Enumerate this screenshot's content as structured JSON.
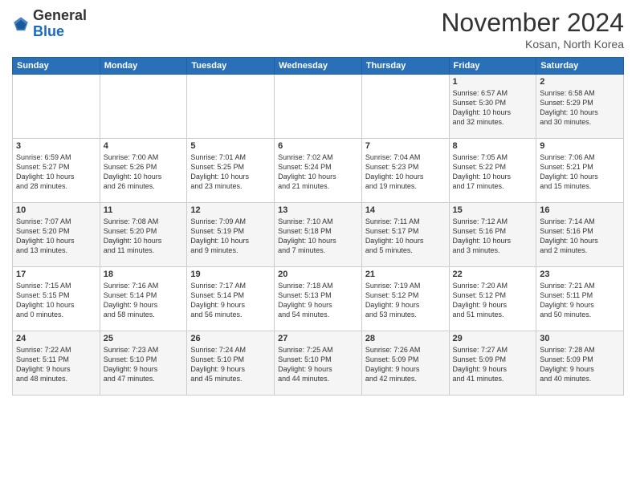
{
  "header": {
    "logo_general": "General",
    "logo_blue": "Blue",
    "month_title": "November 2024",
    "location": "Kosan, North Korea"
  },
  "weekdays": [
    "Sunday",
    "Monday",
    "Tuesday",
    "Wednesday",
    "Thursday",
    "Friday",
    "Saturday"
  ],
  "weeks": [
    [
      {
        "day": "",
        "info": ""
      },
      {
        "day": "",
        "info": ""
      },
      {
        "day": "",
        "info": ""
      },
      {
        "day": "",
        "info": ""
      },
      {
        "day": "",
        "info": ""
      },
      {
        "day": "1",
        "info": "Sunrise: 6:57 AM\nSunset: 5:30 PM\nDaylight: 10 hours\nand 32 minutes."
      },
      {
        "day": "2",
        "info": "Sunrise: 6:58 AM\nSunset: 5:29 PM\nDaylight: 10 hours\nand 30 minutes."
      }
    ],
    [
      {
        "day": "3",
        "info": "Sunrise: 6:59 AM\nSunset: 5:27 PM\nDaylight: 10 hours\nand 28 minutes."
      },
      {
        "day": "4",
        "info": "Sunrise: 7:00 AM\nSunset: 5:26 PM\nDaylight: 10 hours\nand 26 minutes."
      },
      {
        "day": "5",
        "info": "Sunrise: 7:01 AM\nSunset: 5:25 PM\nDaylight: 10 hours\nand 23 minutes."
      },
      {
        "day": "6",
        "info": "Sunrise: 7:02 AM\nSunset: 5:24 PM\nDaylight: 10 hours\nand 21 minutes."
      },
      {
        "day": "7",
        "info": "Sunrise: 7:04 AM\nSunset: 5:23 PM\nDaylight: 10 hours\nand 19 minutes."
      },
      {
        "day": "8",
        "info": "Sunrise: 7:05 AM\nSunset: 5:22 PM\nDaylight: 10 hours\nand 17 minutes."
      },
      {
        "day": "9",
        "info": "Sunrise: 7:06 AM\nSunset: 5:21 PM\nDaylight: 10 hours\nand 15 minutes."
      }
    ],
    [
      {
        "day": "10",
        "info": "Sunrise: 7:07 AM\nSunset: 5:20 PM\nDaylight: 10 hours\nand 13 minutes."
      },
      {
        "day": "11",
        "info": "Sunrise: 7:08 AM\nSunset: 5:20 PM\nDaylight: 10 hours\nand 11 minutes."
      },
      {
        "day": "12",
        "info": "Sunrise: 7:09 AM\nSunset: 5:19 PM\nDaylight: 10 hours\nand 9 minutes."
      },
      {
        "day": "13",
        "info": "Sunrise: 7:10 AM\nSunset: 5:18 PM\nDaylight: 10 hours\nand 7 minutes."
      },
      {
        "day": "14",
        "info": "Sunrise: 7:11 AM\nSunset: 5:17 PM\nDaylight: 10 hours\nand 5 minutes."
      },
      {
        "day": "15",
        "info": "Sunrise: 7:12 AM\nSunset: 5:16 PM\nDaylight: 10 hours\nand 3 minutes."
      },
      {
        "day": "16",
        "info": "Sunrise: 7:14 AM\nSunset: 5:16 PM\nDaylight: 10 hours\nand 2 minutes."
      }
    ],
    [
      {
        "day": "17",
        "info": "Sunrise: 7:15 AM\nSunset: 5:15 PM\nDaylight: 10 hours\nand 0 minutes."
      },
      {
        "day": "18",
        "info": "Sunrise: 7:16 AM\nSunset: 5:14 PM\nDaylight: 9 hours\nand 58 minutes."
      },
      {
        "day": "19",
        "info": "Sunrise: 7:17 AM\nSunset: 5:14 PM\nDaylight: 9 hours\nand 56 minutes."
      },
      {
        "day": "20",
        "info": "Sunrise: 7:18 AM\nSunset: 5:13 PM\nDaylight: 9 hours\nand 54 minutes."
      },
      {
        "day": "21",
        "info": "Sunrise: 7:19 AM\nSunset: 5:12 PM\nDaylight: 9 hours\nand 53 minutes."
      },
      {
        "day": "22",
        "info": "Sunrise: 7:20 AM\nSunset: 5:12 PM\nDaylight: 9 hours\nand 51 minutes."
      },
      {
        "day": "23",
        "info": "Sunrise: 7:21 AM\nSunset: 5:11 PM\nDaylight: 9 hours\nand 50 minutes."
      }
    ],
    [
      {
        "day": "24",
        "info": "Sunrise: 7:22 AM\nSunset: 5:11 PM\nDaylight: 9 hours\nand 48 minutes."
      },
      {
        "day": "25",
        "info": "Sunrise: 7:23 AM\nSunset: 5:10 PM\nDaylight: 9 hours\nand 47 minutes."
      },
      {
        "day": "26",
        "info": "Sunrise: 7:24 AM\nSunset: 5:10 PM\nDaylight: 9 hours\nand 45 minutes."
      },
      {
        "day": "27",
        "info": "Sunrise: 7:25 AM\nSunset: 5:10 PM\nDaylight: 9 hours\nand 44 minutes."
      },
      {
        "day": "28",
        "info": "Sunrise: 7:26 AM\nSunset: 5:09 PM\nDaylight: 9 hours\nand 42 minutes."
      },
      {
        "day": "29",
        "info": "Sunrise: 7:27 AM\nSunset: 5:09 PM\nDaylight: 9 hours\nand 41 minutes."
      },
      {
        "day": "30",
        "info": "Sunrise: 7:28 AM\nSunset: 5:09 PM\nDaylight: 9 hours\nand 40 minutes."
      }
    ]
  ]
}
